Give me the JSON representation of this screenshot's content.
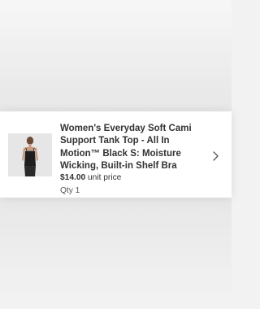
{
  "item": {
    "title": "Women's Everyday Soft Cami Support Tank Top - All In Motion™ Black S: Moisture Wicking, Built-in Shelf Bra",
    "price": "$14.00",
    "price_suffix": "unit price",
    "quantity": "Qty 1",
    "image_icon": "product-thumbnail",
    "chevron_icon": "chevron-right-icon"
  }
}
